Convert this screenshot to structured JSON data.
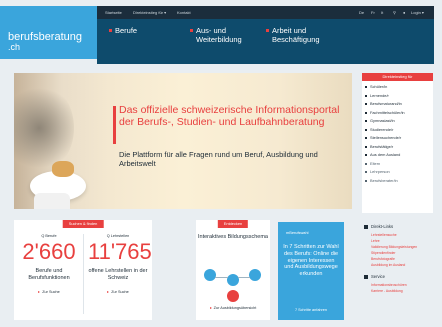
{
  "brand": {
    "line1": "berufsberatung",
    "line2": ".ch"
  },
  "topbar": {
    "links": [
      "Startseite",
      "Direkteinstieg für ▾",
      "Kontakt"
    ],
    "languages": [
      "De",
      "Fr",
      "It"
    ],
    "login": "Login ▾"
  },
  "nav": [
    {
      "label": "Berufe"
    },
    {
      "label": "Aus- und Weiterbildung"
    },
    {
      "label": "Arbeit und Beschäftigung"
    }
  ],
  "hero": {
    "headline": "Das offizielle schweizerische Informationsportal der Berufs-, Studien- und Laufbahnberatung",
    "sub": "Die Plattform für alle Fragen rund um Beruf, Ausbildung und Arbeitswelt"
  },
  "sidebar": {
    "title": "Direkteinstieg für",
    "items": [
      {
        "label": "Schüler/in",
        "light": false
      },
      {
        "label": "Lernende/r",
        "light": false
      },
      {
        "label": "Berufsmaturand/in",
        "light": false
      },
      {
        "label": "Fachmittelschüler/in",
        "light": false
      },
      {
        "label": "Gymnasiast/in",
        "light": false
      },
      {
        "label": "Studierende/r",
        "light": false
      },
      {
        "label": "Stellensuchende/r",
        "light": false
      },
      {
        "label": "Berufstätige/r",
        "light": false
      },
      {
        "label": "Aus dem Ausland",
        "light": false
      },
      {
        "label": "Eltern",
        "light": true
      },
      {
        "label": "Lehrperson",
        "light": true
      },
      {
        "label": "Berufsberater/in",
        "light": true
      }
    ]
  },
  "stats": {
    "tab": "Suchen & finden",
    "left": {
      "label": "Q Berufe",
      "number": "2'660",
      "desc": "Berufe und Berufsfunktionen",
      "more": "Zur Suche"
    },
    "right": {
      "label": "Q Lehrstellen",
      "number": "11'765",
      "desc": "offene Lehrstellen in der Schweiz",
      "more": "Zur Suche"
    }
  },
  "bildung": {
    "tab": "Entdecken",
    "title": "Interaktives Bildungsschema",
    "more": "Zur Ausbildungsübersicht"
  },
  "promo": {
    "head": "mBerufswahl",
    "text": "In 7 Schritten zur Wahl des Berufs: Online die eigenen Interessen und Ausbildungswege erkunden",
    "more": "7 Schritte anfahren"
  },
  "links": {
    "section1": "Direkt-Links",
    "items1": [
      "Lehrstellensuche",
      "Lehre",
      "Validierung Bildungsleistungen",
      "Stipendienfinder",
      "Berufsfotografie",
      "Ausbildung im Ausland"
    ],
    "section2": "Service",
    "items2": [
      "Informationsbroschüren",
      "Karriere - Ausbildung"
    ]
  }
}
